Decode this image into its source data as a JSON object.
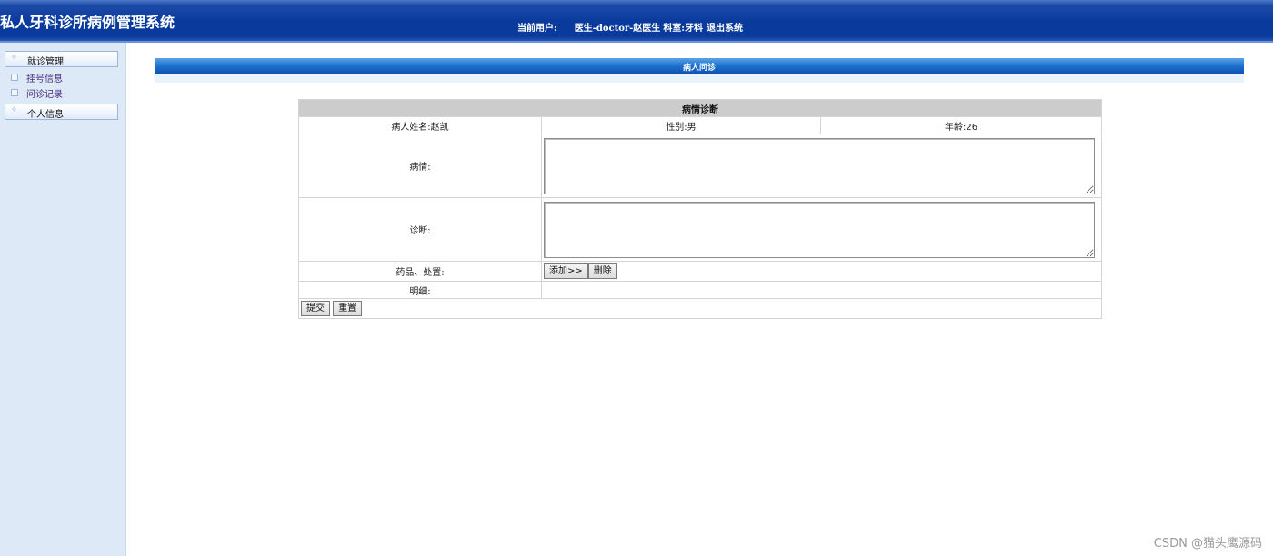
{
  "header": {
    "app_title": "私人牙科诊所病例管理系统",
    "current_user_label": "当前用户:",
    "user": "医生-doctor-赵医生",
    "department": "科室:牙科",
    "logout": "退出系统"
  },
  "sidebar": {
    "groups": [
      {
        "label": "就诊管理",
        "items": [
          {
            "label": "挂号信息"
          },
          {
            "label": "问诊记录"
          }
        ]
      },
      {
        "label": "个人信息",
        "items": []
      }
    ]
  },
  "section": {
    "title": "病人问诊"
  },
  "form": {
    "heading": "病情诊断",
    "patient_name": "病人姓名:赵凯",
    "gender": "性别:男",
    "age": "年龄:26",
    "condition_label": "病情:",
    "condition_value": "",
    "diagnosis_label": "诊断:",
    "diagnosis_value": "",
    "medicine_label": "药品、处置:",
    "add_button": "添加>>",
    "delete_button": "删除",
    "details_label": "明细:",
    "details_value": "",
    "submit_button": "提交",
    "reset_button": "重置"
  },
  "watermark": "CSDN @猫头鹰源码",
  "colors": {
    "header_blue": "#0a3a9c",
    "section_blue": "#1f73cf",
    "sidebar_bg": "#dde9f7",
    "table_head": "#cccccc",
    "sidebar_link": "#4b2f7f"
  }
}
